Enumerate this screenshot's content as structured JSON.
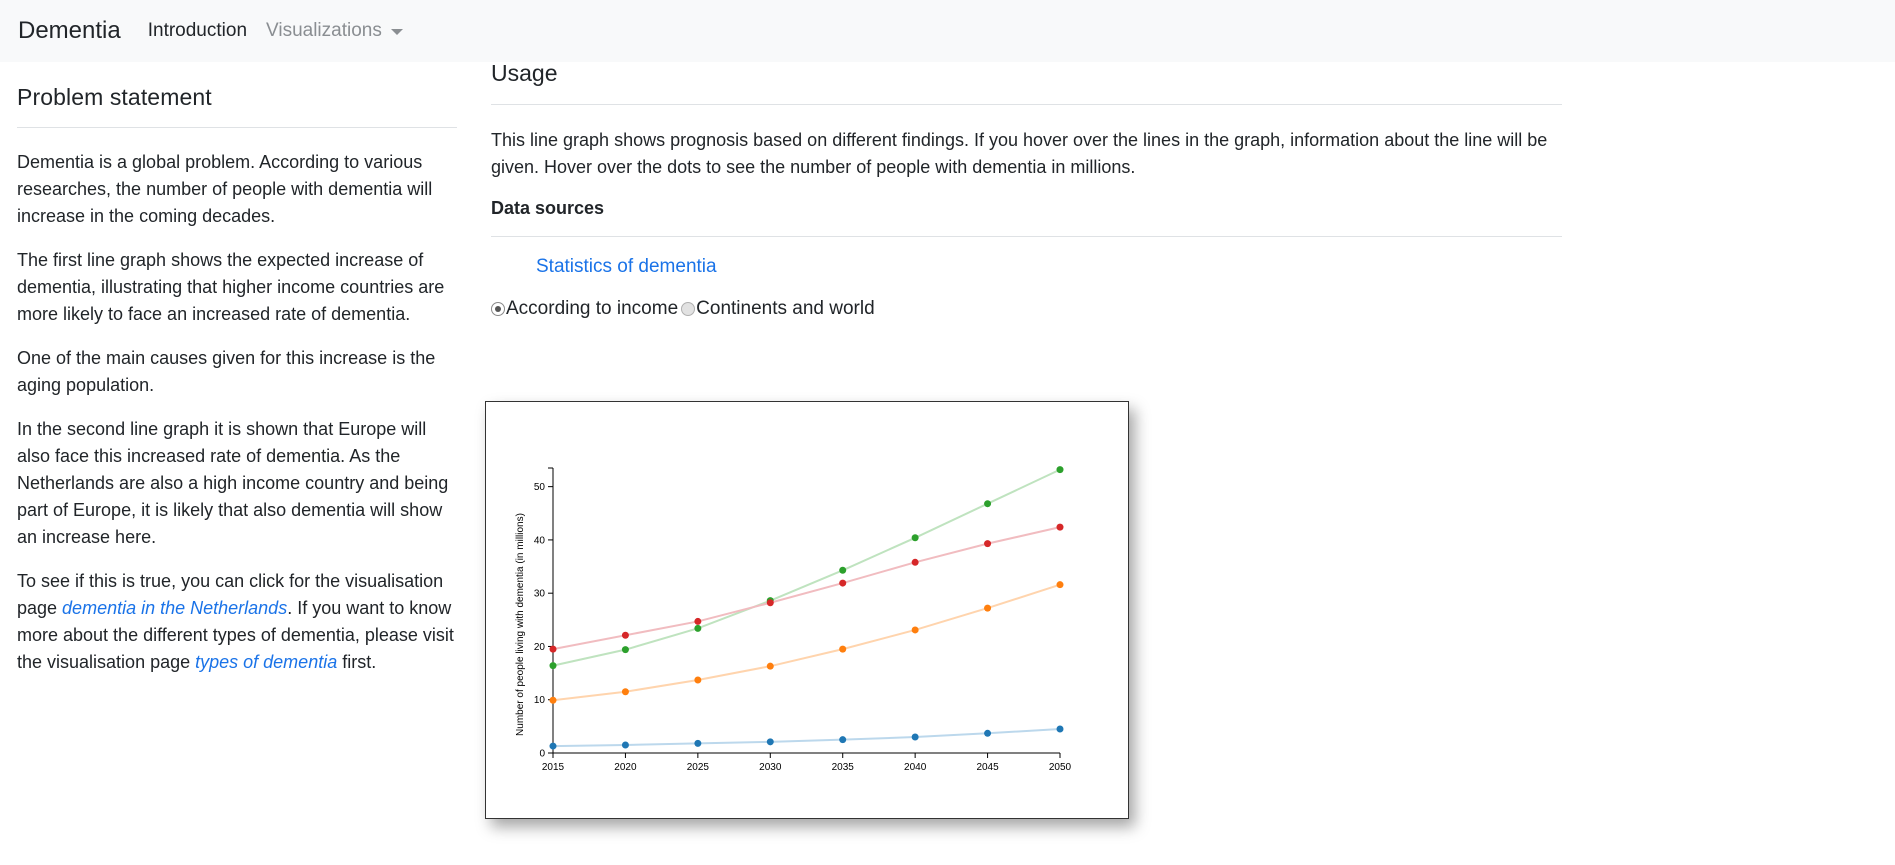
{
  "navbar": {
    "brand": "Dementia",
    "links": [
      {
        "label": "Introduction"
      },
      {
        "label": "Visualizations"
      }
    ]
  },
  "problem": {
    "title": "Problem statement",
    "p1": "Dementia is a global problem. According to various researches, the number of people with dementia will increase in the coming decades.",
    "p2": "The first line graph shows the expected increase of dementia, illustrating that higher income countries are more likely to face an increased rate of dementia.",
    "p3": "One of the main causes given for this increase is the aging population.",
    "p4": "In the second line graph it is shown that Europe will also face this increased rate of dementia. As the Netherlands are also a high income country and being part of Europe, it is likely that also dementia will show an increase here.",
    "p5_part1": "To see if this is true, you can click for the visualisation page ",
    "p5_link1": "dementia in the Netherlands",
    "p5_part2": ". If you want to know more about the different types of dementia, please visit the visualisation page ",
    "p5_link2": "types of dementia",
    "p5_part3": " first."
  },
  "usage": {
    "title": "Usage",
    "description": "This line graph shows prognosis based on different findings. If you hover over the lines in the graph, information about the line will be given. Hover over the dots to see the number of people with dementia in millions.",
    "sources_title": "Data sources",
    "source_link": "Statistics of dementia"
  },
  "radios": [
    {
      "label": "According to income",
      "checked": true
    },
    {
      "label": "Continents and world",
      "checked": false
    }
  ],
  "chart_data": {
    "type": "line",
    "x": [
      2015,
      2020,
      2025,
      2030,
      2035,
      2040,
      2045,
      2050
    ],
    "ylabel": "Number of people living with dementia (in millions)",
    "ylim": [
      0,
      53.5
    ],
    "yticks": [
      0,
      10,
      20,
      30,
      40,
      50
    ],
    "grid": false,
    "series": [
      {
        "color": "#2ca02c",
        "line_color": "#bfe3bf",
        "values": [
          16.4,
          19.4,
          23.4,
          28.6,
          34.3,
          40.4,
          46.8,
          53.2
        ]
      },
      {
        "color": "#d62728",
        "line_color": "#f1bcc0",
        "values": [
          19.5,
          22.1,
          24.7,
          28.2,
          31.9,
          35.8,
          39.3,
          42.4
        ]
      },
      {
        "color": "#ff7f0e",
        "line_color": "#ffd4ad",
        "values": [
          9.9,
          11.5,
          13.7,
          16.3,
          19.5,
          23.1,
          27.2,
          31.6
        ]
      },
      {
        "color": "#1f77b4",
        "line_color": "#bcd8ec",
        "values": [
          1.3,
          1.5,
          1.8,
          2.1,
          2.5,
          3.0,
          3.7,
          4.5
        ]
      }
    ]
  }
}
